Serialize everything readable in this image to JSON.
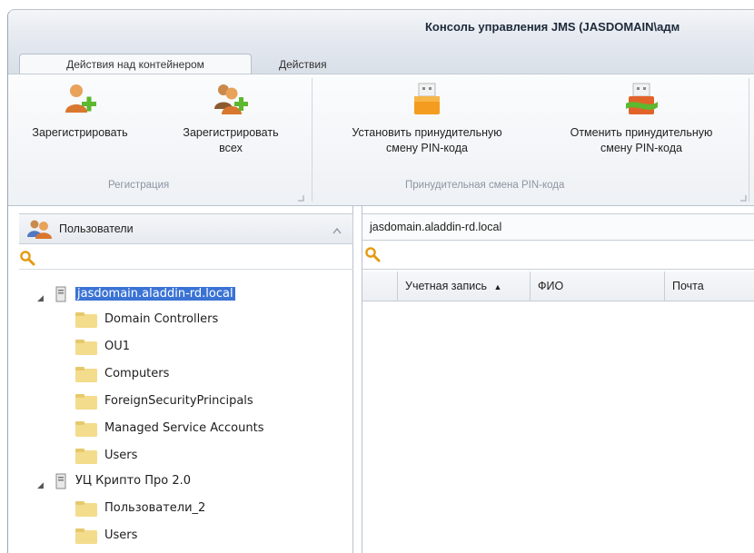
{
  "window": {
    "title": "Консоль управления JMS (JASDOMAIN\\адм"
  },
  "tabs": [
    {
      "label": "Действия над контейнером"
    },
    {
      "label": "Действия"
    }
  ],
  "ribbon": {
    "groups": [
      {
        "label": "Регистрация",
        "buttons": [
          {
            "label_line1": "Зарегистрировать",
            "label_line2": "",
            "icon": "user-add-icon"
          },
          {
            "label_line1": "Зарегистрировать",
            "label_line2": "всех",
            "icon": "users-add-icon"
          }
        ]
      },
      {
        "label": "Принудительная смена PIN-кода",
        "buttons": [
          {
            "label_line1": "Установить принудительную",
            "label_line2": "смену PIN-кода",
            "icon": "token-set-icon"
          },
          {
            "label_line1": "Отменить принудительную",
            "label_line2": "смену PIN-кода",
            "icon": "token-cancel-icon"
          }
        ]
      }
    ]
  },
  "left_panel": {
    "title": "Пользователи",
    "tree": [
      {
        "label": "jasdomain.aladdin-rd.local",
        "level": 0,
        "selected": true,
        "expanded": true
      },
      {
        "label": "Domain Controllers",
        "level": 1
      },
      {
        "label": "OU1",
        "level": 1
      },
      {
        "label": "Computers",
        "level": 1
      },
      {
        "label": "ForeignSecurityPrincipals",
        "level": 1
      },
      {
        "label": "Managed Service Accounts",
        "level": 1
      },
      {
        "label": "Users",
        "level": 1
      },
      {
        "label": "УЦ Крипто Про 2.0",
        "level": 0,
        "expanded": true
      },
      {
        "label": "Пользователи_2",
        "level": 1
      },
      {
        "label": "Users",
        "level": 1
      }
    ]
  },
  "right_panel": {
    "path": "jasdomain.aladdin-rd.local",
    "columns": [
      {
        "label": "Учетная запись",
        "sort": "asc"
      },
      {
        "label": "ФИО"
      },
      {
        "label": "Почта"
      }
    ]
  },
  "colors": {
    "selection": "#3a73d4",
    "folder": "#f3dc8c",
    "search_icon": "#e69a12",
    "accent_green": "#5cb82e"
  }
}
